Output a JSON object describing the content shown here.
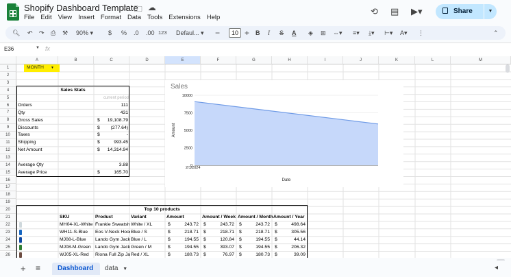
{
  "app": {
    "title": "Shopify Dashboard Template",
    "menu": [
      "File",
      "Edit",
      "View",
      "Insert",
      "Format",
      "Data",
      "Tools",
      "Extensions",
      "Help"
    ],
    "share_label": "Share"
  },
  "toolbar": {
    "zoom": "90%",
    "currency": "$",
    "percent": "%",
    "dec_dec": ".0",
    "dec_inc": ".00",
    "number_format": "123",
    "font": "Defaul...",
    "font_size": "10",
    "bold": "B",
    "italic": "I",
    "text_color": "A"
  },
  "formula_bar": {
    "cell_ref": "E36",
    "fx": "fx"
  },
  "columns": [
    "A",
    "B",
    "C",
    "D",
    "E",
    "F",
    "G",
    "H",
    "I",
    "J",
    "K",
    "L",
    "M"
  ],
  "rows": [
    "1",
    "2",
    "3",
    "4",
    "5",
    "6",
    "7",
    "8",
    "9",
    "10",
    "11",
    "12",
    "13",
    "14",
    "15",
    "16",
    "17",
    "18",
    "19",
    "20",
    "21",
    "22",
    "23",
    "24",
    "25",
    "26"
  ],
  "month_select": {
    "label": "MONTH"
  },
  "sales_stats": {
    "title": "Sales Stats",
    "period_label": "current period",
    "rows": [
      {
        "label": "Orders",
        "cur": "",
        "value": "111"
      },
      {
        "label": "Qty",
        "cur": "",
        "value": "431"
      },
      {
        "label": "Gross Sales",
        "cur": "$",
        "value": "19,108.79"
      },
      {
        "label": "Discounts",
        "cur": "$",
        "value": "(277.64)"
      },
      {
        "label": "Taxes",
        "cur": "$",
        "value": "-"
      },
      {
        "label": "Shipping",
        "cur": "$",
        "value": "993.45"
      },
      {
        "label": "Net Amount",
        "cur": "$",
        "value": "14,314.94"
      }
    ],
    "avg_qty_label": "Average Qty",
    "avg_qty": "3.88",
    "avg_price_label": "Average Price",
    "avg_price_cur": "$",
    "avg_price": "165.70"
  },
  "chart_data": {
    "type": "area",
    "title": "Sales",
    "xlabel": "Date",
    "ylabel": "Amount",
    "x": [
      "2/1/2024",
      ""
    ],
    "series": [
      {
        "values": [
          9100,
          5900
        ]
      }
    ],
    "ylim": [
      0,
      10000
    ],
    "yticks": [
      "0",
      "2500",
      "5000",
      "7500",
      "10000"
    ],
    "grid": true,
    "color": "#c6d8fa",
    "line_color": "#6e9ae6"
  },
  "top10": {
    "title": "Top 10 products",
    "headers": [
      "SKU",
      "Product",
      "Variant",
      "Amount",
      "Amount / Week",
      "Amount / Month",
      "Amount / Year"
    ],
    "rows": [
      {
        "sku": "MH04-XL-White",
        "product": "Frankie  Sweatsh",
        "variant": "White / XL",
        "amount": "243.72",
        "week": "243.72",
        "month": "243.72",
        "year": "498.64",
        "thumb": "#cfd8dc"
      },
      {
        "sku": "WH11-S-Blue",
        "product": "Eos V-Neck Hood",
        "variant": "Blue / S",
        "amount": "218.71",
        "week": "218.71",
        "month": "218.71",
        "year": "305.56",
        "thumb": "#1565c0"
      },
      {
        "sku": "MJ08-L-Blue",
        "product": "Lando Gym Jacke",
        "variant": "Blue / L",
        "amount": "194.55",
        "week": "120.84",
        "month": "194.55",
        "year": "44.14",
        "thumb": "#0d47a1"
      },
      {
        "sku": "MJ08-M-Green",
        "product": "Lando Gym Jacke",
        "variant": "Green / M",
        "amount": "194.55",
        "week": "393.07",
        "month": "194.55",
        "year": "206.32",
        "thumb": "#2e7d32"
      },
      {
        "sku": "WJ05-XL-Red",
        "product": "Riona Full Zip Ja",
        "variant": "Red / XL",
        "amount": "180.73",
        "week": "76.97",
        "month": "180.73",
        "year": "39.09",
        "thumb": "#6d4c41"
      }
    ],
    "cur": "$"
  },
  "tabs": {
    "active": "Dashboard",
    "other": "data"
  }
}
